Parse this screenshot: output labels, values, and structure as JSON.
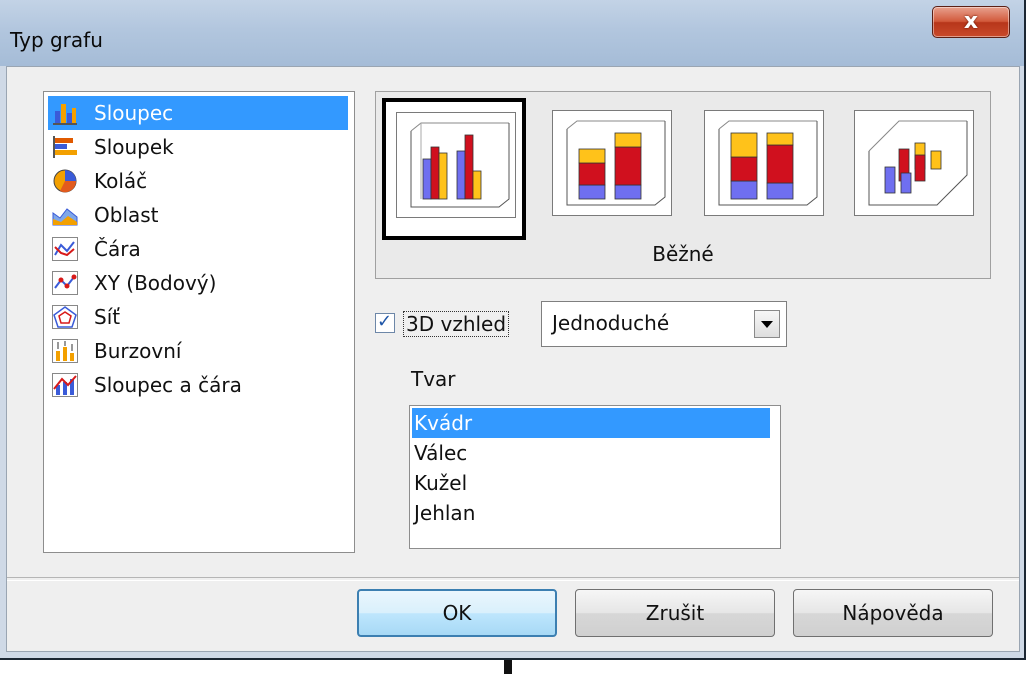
{
  "window": {
    "title": "Typ grafu",
    "close_glyph": "x"
  },
  "chart_types": [
    {
      "label": "Sloupec",
      "icon": "column-chart-icon",
      "selected": true
    },
    {
      "label": "Sloupek",
      "icon": "bar-chart-icon",
      "selected": false
    },
    {
      "label": "Koláč",
      "icon": "pie-chart-icon",
      "selected": false
    },
    {
      "label": "Oblast",
      "icon": "area-chart-icon",
      "selected": false
    },
    {
      "label": "Čára",
      "icon": "line-chart-icon",
      "selected": false
    },
    {
      "label": "XY (Bodový)",
      "icon": "scatter-chart-icon",
      "selected": false
    },
    {
      "label": "Síť",
      "icon": "net-chart-icon",
      "selected": false
    },
    {
      "label": "Burzovní",
      "icon": "stock-chart-icon",
      "selected": false
    },
    {
      "label": "Sloupec a čára",
      "icon": "column-line-chart-icon",
      "selected": false
    }
  ],
  "subtypes": {
    "caption": "Běžné",
    "variants": [
      {
        "name": "normal",
        "selected": true
      },
      {
        "name": "stacked",
        "selected": false
      },
      {
        "name": "percent-stacked",
        "selected": false
      },
      {
        "name": "deep",
        "selected": false
      }
    ]
  },
  "three_d": {
    "checked": true,
    "label": "3D vzhled",
    "check_glyph": "✓",
    "style_value": "Jednoduché"
  },
  "shape": {
    "label": "Tvar",
    "options": [
      {
        "label": "Kvádr",
        "selected": true
      },
      {
        "label": "Válec",
        "selected": false
      },
      {
        "label": "Kužel",
        "selected": false
      },
      {
        "label": "Jehlan",
        "selected": false
      }
    ]
  },
  "buttons": {
    "ok": "OK",
    "cancel": "Zrušit",
    "help": "Nápověda"
  },
  "colors": {
    "selection": "#3399ff",
    "series_blue": "#6f6ff0",
    "series_red": "#d0101e",
    "series_yellow": "#ffc21a"
  }
}
